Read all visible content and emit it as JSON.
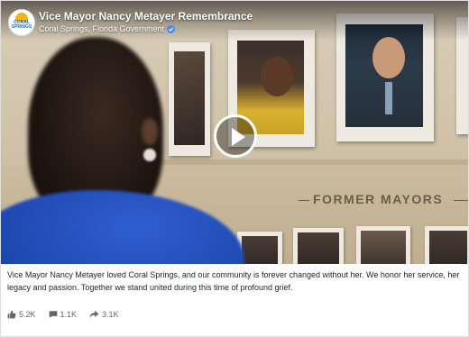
{
  "header": {
    "title": "Vice Mayor Nancy Metayer Remembrance",
    "page_name": "Coral Springs, Florida Government",
    "verified_icon": "verified-badge-icon",
    "logo_text": "CORAL SPRINGS"
  },
  "video": {
    "sign_text": "FORMER MAYORS",
    "play_icon": "play-icon"
  },
  "post": {
    "caption": "Vice Mayor Nancy Metayer loved Coral Springs, and our community is forever changed without her. We honor her service, her legacy and passion. Together we stand united during this time of profound grief."
  },
  "stats": {
    "reactions": "5.2K",
    "comments": "1.1K",
    "shares": "3.1K"
  },
  "colors": {
    "brand_blue": "#4a8df8",
    "text": "#1d2129",
    "muted": "#606770"
  }
}
